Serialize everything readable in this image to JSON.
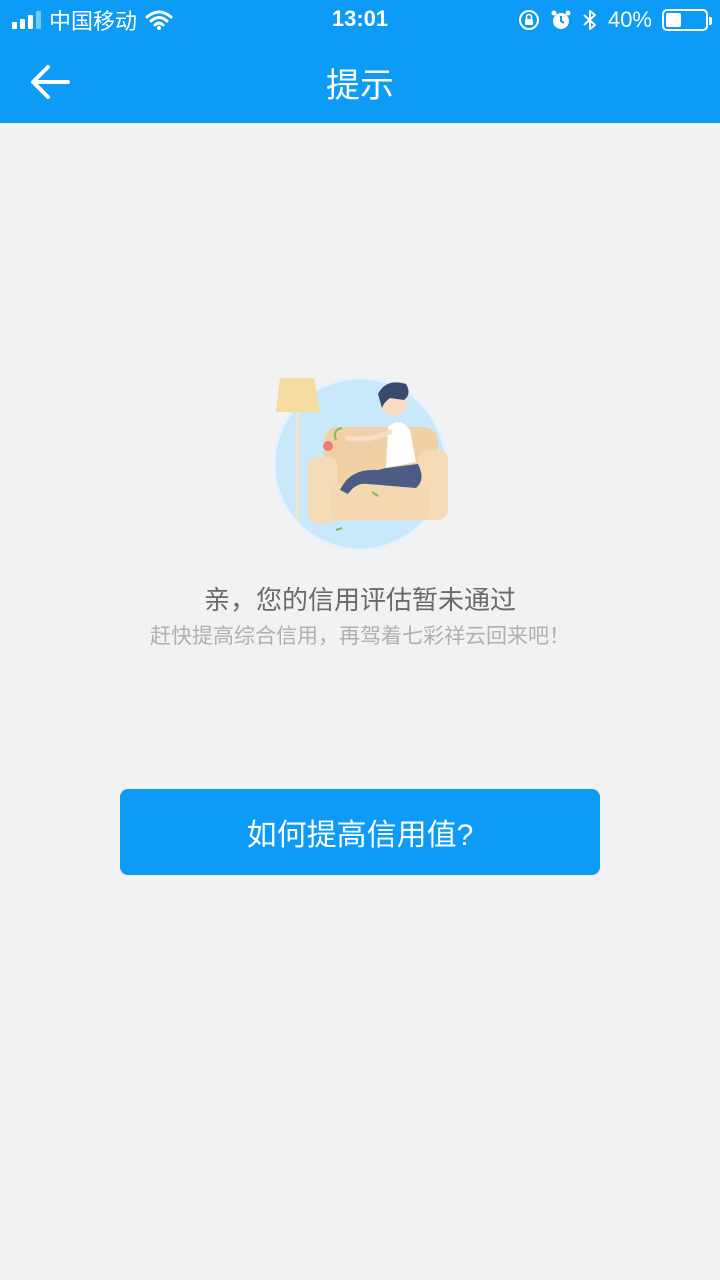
{
  "status_bar": {
    "carrier": "中国移动",
    "time": "13:01",
    "battery_text": "40%",
    "battery_level": 0.4,
    "icons": [
      "signal-icon",
      "wifi-icon",
      "rotation-lock-icon",
      "alarm-icon",
      "bluetooth-icon",
      "battery-icon"
    ]
  },
  "nav": {
    "title": "提示",
    "back_icon": "back-arrow-icon"
  },
  "colors": {
    "primary": "#0c9cf7",
    "background": "#f2f2f2",
    "title_text": "#6a6a6a",
    "subtitle_text": "#b0b0b0"
  },
  "message": {
    "title": "亲，您的信用评估暂未通过",
    "subtitle": "赶快提高综合信用，再驾着七彩祥云回来吧！"
  },
  "cta": {
    "label": "如何提高信用值?"
  }
}
